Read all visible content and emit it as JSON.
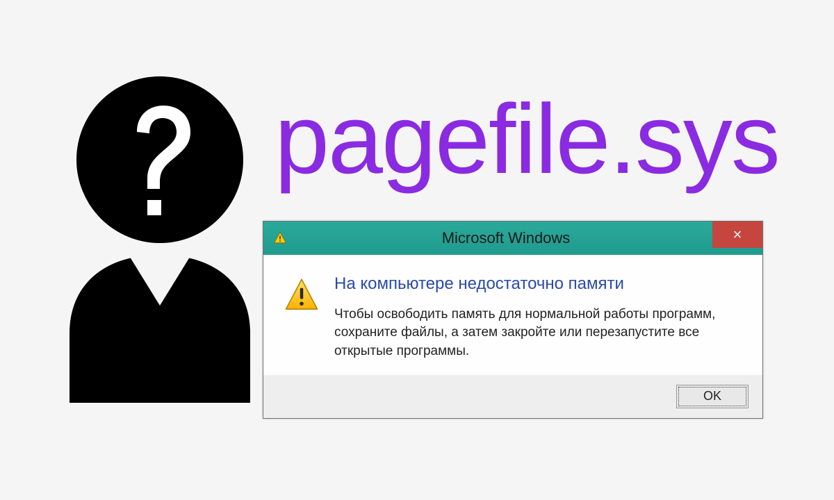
{
  "colors": {
    "title": "#8a2be2",
    "titlebar": "#2aa99b",
    "close_button": "#c5453f",
    "message_heading": "#2a4aa8"
  },
  "main_title": "pagefile.sys",
  "dialog": {
    "title": "Microsoft Windows",
    "close_label": "×",
    "heading": "На компьютере недостаточно памяти",
    "message": "Чтобы освободить память для нормальной работы программ, сохраните файлы, а затем закройте или перезапустите все открытые программы.",
    "ok_label": "OK"
  },
  "icons": {
    "titlebar_warning": "warning-icon",
    "body_warning": "warning-icon",
    "silhouette": "question-person-icon"
  }
}
